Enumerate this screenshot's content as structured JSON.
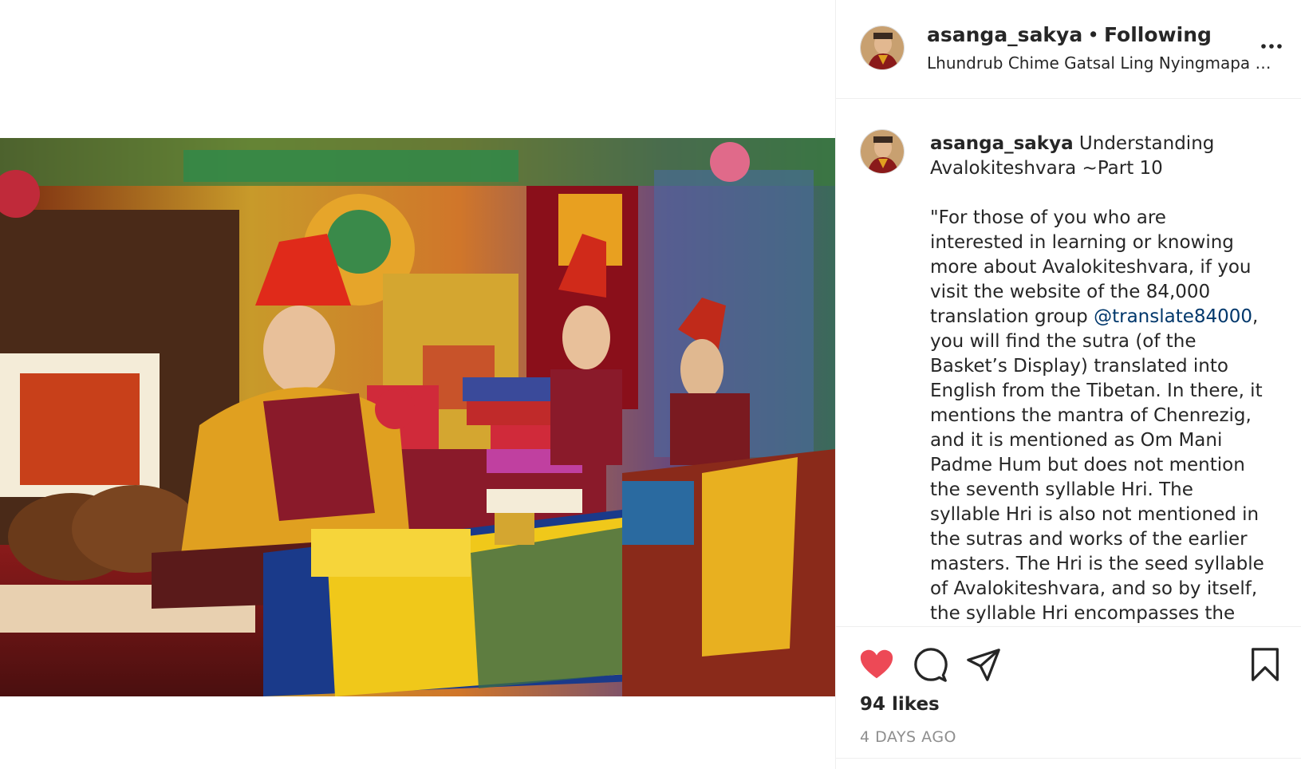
{
  "header": {
    "username": "asanga_sakya",
    "separator": "•",
    "follow_status": "Following",
    "location": "Lhundrub Chime Gatsal Ling Nyingmapa Mon..."
  },
  "caption": {
    "username": "asanga_sakya",
    "title": "Understanding Avalokiteshvara ~Part 10",
    "body_before_mention": "\"For those of you who are interested in learning or knowing more about Avalokiteshvara, if you visit the website of the 84,000 translation group ",
    "mention": "@translate84000",
    "body_after_mention": ", you will find the sutra (of the Basket’s Display) translated into English from the Tibetan. In there, it mentions the mantra of Chenrezig, and it is mentioned as Om Mani Padme Hum but does not mention the seventh syllable Hri. The syllable Hri is also not mentioned in the sutras and works of the earlier masters. The Hri is the seed syllable of Avalokiteshvara, and so by itself, the syllable Hri encompasses the"
  },
  "stats": {
    "likes": "94 likes",
    "timestamp": "4 DAYS AGO"
  },
  "icons": {
    "more": "more-options-icon",
    "like": "heart-icon",
    "comment": "comment-icon",
    "share": "share-icon",
    "save": "bookmark-icon"
  },
  "colors": {
    "like_red": "#ed4956",
    "link_blue": "#00376b",
    "muted": "#8e8e8e",
    "border": "#efefef"
  }
}
